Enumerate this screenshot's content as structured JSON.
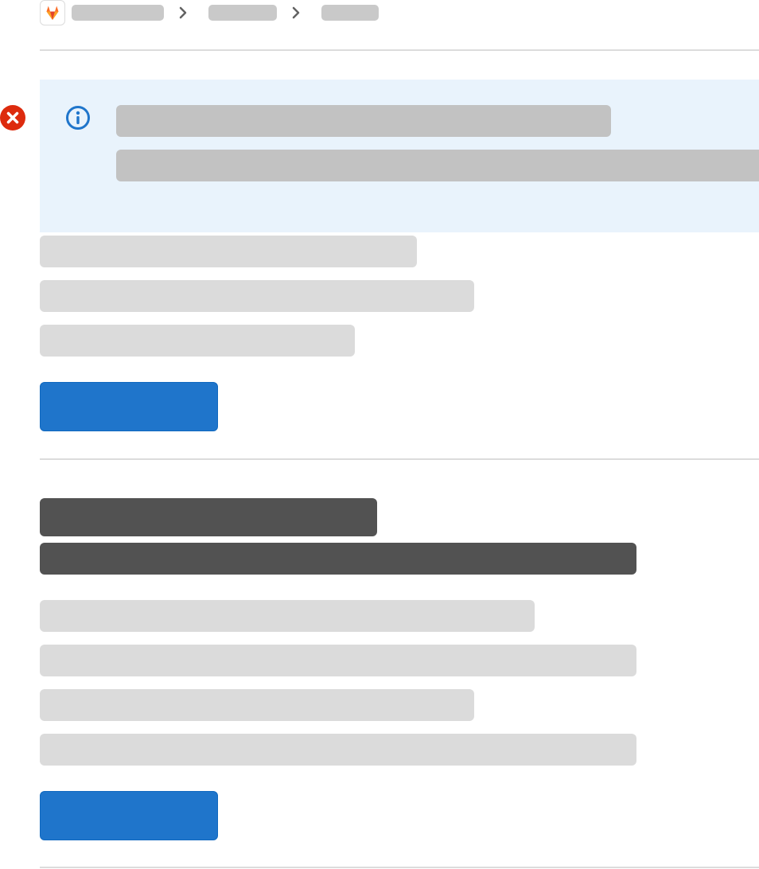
{
  "colors": {
    "accent": "#1f75cb",
    "info_bg": "#e9f3fc",
    "info_icon": "#1f75cb",
    "error_icon": "#dd2b0e",
    "skeleton_light": "#dbdbdb",
    "skeleton_mid": "#c2c2c2",
    "skeleton_dark": "#525252"
  },
  "header": {
    "logo_icon": "gitlab-tanuki-icon",
    "breadcrumb_separator_icon": "chevron-right-icon"
  },
  "alert": {
    "status_icon": "error-x-icon",
    "info_icon": "info-icon"
  }
}
